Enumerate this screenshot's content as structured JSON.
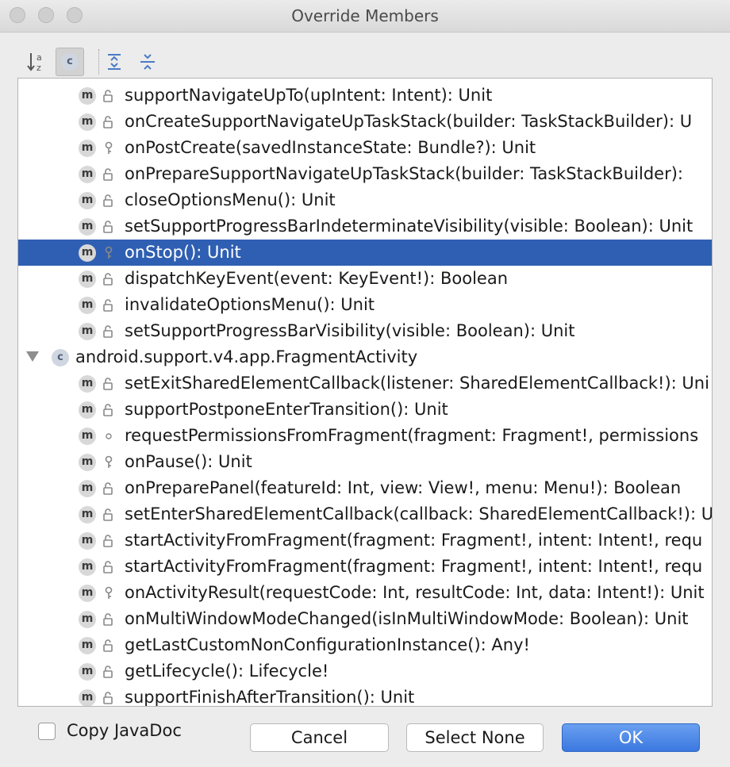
{
  "window": {
    "title": "Override Members"
  },
  "toolbar": {
    "buttons": [
      {
        "name": "sort-alphabetically-button",
        "icon": "sort-alpha-icon",
        "active": false
      },
      {
        "name": "show-classes-button",
        "icon": "class-c-icon",
        "active": true
      },
      {
        "name": "expand-all-button",
        "icon": "expand-all-icon",
        "active": false
      },
      {
        "name": "collapse-all-button",
        "icon": "collapse-all-icon",
        "active": false
      }
    ],
    "class_icon_letter": "c"
  },
  "list": {
    "method_icon_letter": "m",
    "class_icon_letter": "c",
    "rows": [
      {
        "kind": "method",
        "label": "supportNavigateUpTo(upIntent: Intent): Unit",
        "visibility": "public",
        "selected": false
      },
      {
        "kind": "method",
        "label": "onCreateSupportNavigateUpTaskStack(builder: TaskStackBuilder): U",
        "visibility": "public",
        "selected": false
      },
      {
        "kind": "method",
        "label": "onPostCreate(savedInstanceState: Bundle?): Unit",
        "visibility": "protected",
        "selected": false
      },
      {
        "kind": "method",
        "label": "onPrepareSupportNavigateUpTaskStack(builder: TaskStackBuilder):",
        "visibility": "public",
        "selected": false
      },
      {
        "kind": "method",
        "label": "closeOptionsMenu(): Unit",
        "visibility": "public",
        "selected": false
      },
      {
        "kind": "method",
        "label": "setSupportProgressBarIndeterminateVisibility(visible: Boolean): Unit",
        "visibility": "public",
        "selected": false
      },
      {
        "kind": "method",
        "label": "onStop(): Unit",
        "visibility": "protected",
        "selected": true
      },
      {
        "kind": "method",
        "label": "dispatchKeyEvent(event: KeyEvent!): Boolean",
        "visibility": "public",
        "selected": false
      },
      {
        "kind": "method",
        "label": "invalidateOptionsMenu(): Unit",
        "visibility": "public",
        "selected": false
      },
      {
        "kind": "method",
        "label": "setSupportProgressBarVisibility(visible: Boolean): Unit",
        "visibility": "public",
        "selected": false
      },
      {
        "kind": "class",
        "label": "android.support.v4.app.FragmentActivity",
        "visibility": "",
        "selected": false
      },
      {
        "kind": "method",
        "label": "setExitSharedElementCallback(listener: SharedElementCallback!): Uni",
        "visibility": "public",
        "selected": false
      },
      {
        "kind": "method",
        "label": "supportPostponeEnterTransition(): Unit",
        "visibility": "public",
        "selected": false
      },
      {
        "kind": "method",
        "label": "requestPermissionsFromFragment(fragment: Fragment!, permissions",
        "visibility": "package",
        "selected": false
      },
      {
        "kind": "method",
        "label": "onPause(): Unit",
        "visibility": "protected",
        "selected": false
      },
      {
        "kind": "method",
        "label": "onPreparePanel(featureId: Int, view: View!, menu: Menu!): Boolean",
        "visibility": "public",
        "selected": false
      },
      {
        "kind": "method",
        "label": "setEnterSharedElementCallback(callback: SharedElementCallback!): U",
        "visibility": "public",
        "selected": false
      },
      {
        "kind": "method",
        "label": "startActivityFromFragment(fragment: Fragment!, intent: Intent!, requ",
        "visibility": "public",
        "selected": false
      },
      {
        "kind": "method",
        "label": "startActivityFromFragment(fragment: Fragment!, intent: Intent!, requ",
        "visibility": "public",
        "selected": false
      },
      {
        "kind": "method",
        "label": "onActivityResult(requestCode: Int, resultCode: Int, data: Intent!): Unit",
        "visibility": "protected",
        "selected": false
      },
      {
        "kind": "method",
        "label": "onMultiWindowModeChanged(isInMultiWindowMode: Boolean): Unit",
        "visibility": "public",
        "selected": false
      },
      {
        "kind": "method",
        "label": "getLastCustomNonConfigurationInstance(): Any!",
        "visibility": "public",
        "selected": false
      },
      {
        "kind": "method",
        "label": "getLifecycle(): Lifecycle!",
        "visibility": "public",
        "selected": false
      },
      {
        "kind": "method",
        "label": "supportFinishAfterTransition(): Unit",
        "visibility": "public",
        "selected": false
      }
    ]
  },
  "footer": {
    "copy_javadoc_label": "Copy JavaDoc",
    "copy_javadoc_checked": false,
    "cancel_label": "Cancel",
    "select_none_label": "Select None",
    "ok_label": "OK"
  },
  "colors": {
    "selection": "#2f5fb2",
    "primary_button": "#3b78e0"
  }
}
